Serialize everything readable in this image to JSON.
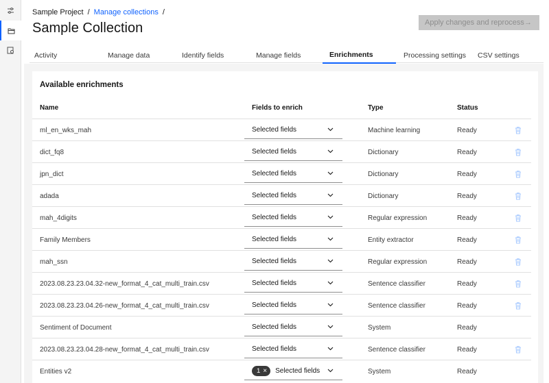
{
  "breadcrumb": {
    "root": "Sample Project",
    "sep1": "/",
    "current": "Manage collections",
    "sep2": "/"
  },
  "page_title": "Sample Collection",
  "apply_button": {
    "label": "Apply changes and reprocess",
    "arrow": "→"
  },
  "tabs": [
    {
      "label": "Activity"
    },
    {
      "label": "Manage data"
    },
    {
      "label": "Identify fields"
    },
    {
      "label": "Manage fields"
    },
    {
      "label": "Enrichments",
      "selected": true
    },
    {
      "label": "Processing settings"
    },
    {
      "label": "CSV settings"
    }
  ],
  "panel": {
    "title": "Available enrichments",
    "columns": {
      "name": "Name",
      "fields": "Fields to enrich",
      "type": "Type",
      "status": "Status"
    },
    "rows": [
      {
        "name": "ml_en_wks_mah",
        "fields": "Selected fields",
        "type": "Machine learning",
        "status": "Ready",
        "deletable": true
      },
      {
        "name": "dict_fq8",
        "fields": "Selected fields",
        "type": "Dictionary",
        "status": "Ready",
        "deletable": true
      },
      {
        "name": "jpn_dict",
        "fields": "Selected fields",
        "type": "Dictionary",
        "status": "Ready",
        "deletable": true
      },
      {
        "name": "adada",
        "fields": "Selected fields",
        "type": "Dictionary",
        "status": "Ready",
        "deletable": true
      },
      {
        "name": "mah_4digits",
        "fields": "Selected fields",
        "type": "Regular expression",
        "status": "Ready",
        "deletable": true
      },
      {
        "name": "Family Members",
        "fields": "Selected fields",
        "type": "Entity extractor",
        "status": "Ready",
        "deletable": true
      },
      {
        "name": "mah_ssn",
        "fields": "Selected fields",
        "type": "Regular expression",
        "status": "Ready",
        "deletable": true
      },
      {
        "name": "2023.08.23.23.04.32-new_format_4_cat_multi_train.csv",
        "fields": "Selected fields",
        "type": "Sentence classifier",
        "status": "Ready",
        "deletable": true
      },
      {
        "name": "2023.08.23.23.04.26-new_format_4_cat_multi_train.csv",
        "fields": "Selected fields",
        "type": "Sentence classifier",
        "status": "Ready",
        "deletable": true
      },
      {
        "name": "Sentiment of Document",
        "fields": "Selected fields",
        "type": "System",
        "status": "Ready",
        "deletable": false
      },
      {
        "name": "2023.08.23.23.04.28-new_format_4_cat_multi_train.csv",
        "fields": "Selected fields",
        "type": "Sentence classifier",
        "status": "Ready",
        "deletable": true
      },
      {
        "name": "Entities v2",
        "fields": "Selected fields",
        "tag_count": "1",
        "tag_close": "×",
        "type": "System",
        "status": "Ready",
        "deletable": false
      }
    ]
  },
  "icons": {
    "rail": [
      "sliders-icon",
      "folder-icon",
      "settings-document-icon"
    ],
    "dropdown": "chevron-down-icon",
    "delete": "trash-icon"
  },
  "colors": {
    "accent": "#0f62fe",
    "disabled_button": "#c6c6c6",
    "trash": "#a6c8ff"
  }
}
